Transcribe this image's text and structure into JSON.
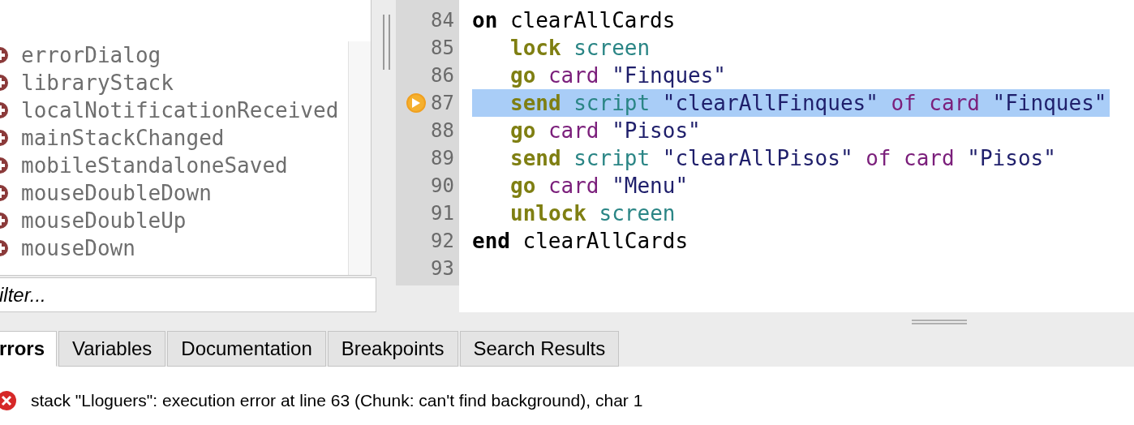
{
  "handlers": [
    {
      "name": "errorDialog"
    },
    {
      "name": "libraryStack"
    },
    {
      "name": "localNotificationReceived"
    },
    {
      "name": "mainStackChanged"
    },
    {
      "name": "mobileStandaloneSaved"
    },
    {
      "name": "mouseDoubleDown"
    },
    {
      "name": "mouseDoubleUp"
    },
    {
      "name": "mouseDown"
    }
  ],
  "filter": {
    "placeholder": "ilter..."
  },
  "code": [
    {
      "number": "84",
      "kind": "top",
      "highlighted": false,
      "breakpoint": false,
      "tokens": [
        {
          "kind": "keyword",
          "text": "on"
        },
        {
          "kind": "plain",
          "text": "clearAllCards"
        }
      ]
    },
    {
      "number": "85",
      "kind": "body",
      "highlighted": false,
      "breakpoint": false,
      "tokens": [
        {
          "kind": "command",
          "text": "lock"
        },
        {
          "kind": "property",
          "text": "screen"
        }
      ]
    },
    {
      "number": "86",
      "kind": "body",
      "highlighted": false,
      "breakpoint": false,
      "tokens": [
        {
          "kind": "command",
          "text": "go"
        },
        {
          "kind": "object",
          "text": "card"
        },
        {
          "kind": "string",
          "text": "\"Finques\""
        }
      ]
    },
    {
      "number": "87",
      "kind": "body",
      "highlighted": true,
      "breakpoint": true,
      "tokens": [
        {
          "kind": "command",
          "text": "send"
        },
        {
          "kind": "property",
          "text": "script"
        },
        {
          "kind": "string",
          "text": "\"clearAllFinques\""
        },
        {
          "kind": "object",
          "text": "of"
        },
        {
          "kind": "object",
          "text": "card"
        },
        {
          "kind": "string",
          "text": "\"Finques\""
        }
      ]
    },
    {
      "number": "88",
      "kind": "body",
      "highlighted": false,
      "breakpoint": false,
      "tokens": [
        {
          "kind": "command",
          "text": "go"
        },
        {
          "kind": "object",
          "text": "card"
        },
        {
          "kind": "string",
          "text": "\"Pisos\""
        }
      ]
    },
    {
      "number": "89",
      "kind": "body",
      "highlighted": false,
      "breakpoint": false,
      "tokens": [
        {
          "kind": "command",
          "text": "send"
        },
        {
          "kind": "property",
          "text": "script"
        },
        {
          "kind": "string",
          "text": "\"clearAllPisos\""
        },
        {
          "kind": "object",
          "text": "of"
        },
        {
          "kind": "object",
          "text": "card"
        },
        {
          "kind": "string",
          "text": "\"Pisos\""
        }
      ]
    },
    {
      "number": "90",
      "kind": "body",
      "highlighted": false,
      "breakpoint": false,
      "tokens": [
        {
          "kind": "command",
          "text": "go"
        },
        {
          "kind": "object",
          "text": "card"
        },
        {
          "kind": "string",
          "text": "\"Menu\""
        }
      ]
    },
    {
      "number": "91",
      "kind": "body",
      "highlighted": false,
      "breakpoint": false,
      "tokens": [
        {
          "kind": "command",
          "text": "unlock"
        },
        {
          "kind": "property",
          "text": "screen"
        }
      ]
    },
    {
      "number": "92",
      "kind": "top",
      "highlighted": false,
      "breakpoint": false,
      "tokens": [
        {
          "kind": "keyword",
          "text": "end"
        },
        {
          "kind": "plain",
          "text": "clearAllCards"
        }
      ]
    },
    {
      "number": "93",
      "kind": "top",
      "highlighted": false,
      "breakpoint": false
    }
  ],
  "tabs": [
    {
      "label": "rrors",
      "selected": true
    },
    {
      "label": "Variables",
      "selected": false
    },
    {
      "label": "Documentation",
      "selected": false
    },
    {
      "label": "Breakpoints",
      "selected": false
    },
    {
      "label": "Search Results",
      "selected": false
    }
  ],
  "errors": [
    {
      "message": "stack \"Lloguers\": execution error at line 63 (Chunk: can't find background), char 1"
    }
  ]
}
